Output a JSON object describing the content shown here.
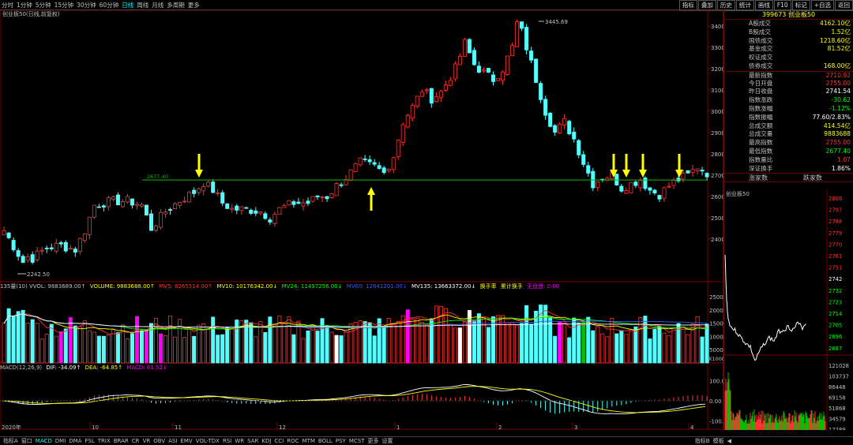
{
  "topbar": {
    "periods": [
      "分时",
      "1分钟",
      "5分钟",
      "15分钟",
      "30分钟",
      "60分钟",
      "日线",
      "周线",
      "月线",
      "多周期",
      "更多"
    ],
    "selected": "日线",
    "tools": [
      "指标",
      "叠加",
      "历史",
      "统计",
      "画线",
      "F10",
      "标记",
      "+自选",
      "返回"
    ]
  },
  "chart": {
    "title": "创业板50(日线,前复权)",
    "support_label": "2677.40",
    "high_label": "3445.69",
    "low_label": "2242.50",
    "price_axis": [
      "3400",
      "3300",
      "3200",
      "3100",
      "3000",
      "2900",
      "2800",
      "2700",
      "2600",
      "2500",
      "2400"
    ],
    "vol_axis": [
      "25000",
      "20000",
      "15000",
      "10000",
      "5000",
      "X1000"
    ],
    "macd_axis": [
      "100.00",
      "0.00",
      "-100.00"
    ],
    "x_axis": [
      "2020年",
      "10",
      "11",
      "12",
      "1",
      "2",
      "3",
      "4"
    ],
    "colors": {
      "up": "#ff3232",
      "down": "#54ffff",
      "support": "#00c000",
      "arrow": "#ffff00"
    }
  },
  "vol_title": {
    "p1": "135量(10) VVOL: 9883689.00↑",
    "volume": "VOLUME: 9883688.00↑",
    "mv5": "MV5: 8265514.00↑",
    "mv10": "MV10: 10176342.00↓",
    "mv24": "MV24: 11497256.00↓",
    "mv60": "MV60: 12641201.00↓",
    "mv135": "MV135: 13663372.00↓",
    "hs": "换手率",
    "lj": "累计换手",
    "cx": "无盘盘: 0.00"
  },
  "macd_title": {
    "p1": "MACD(12,26,9)",
    "dif": "DIF: -34.09↑",
    "dea": "DEA: -64.85↑",
    "macd": "MACD: 61.52↓"
  },
  "panel": {
    "title": "399673 创业板50",
    "rows": [
      {
        "label": "A股成交",
        "value": "4162.10亿",
        "color": "#ffff00"
      },
      {
        "label": "B股成交",
        "value": "1.52亿",
        "color": "#ffff00"
      },
      {
        "label": "国债成交",
        "value": "1218.60亿",
        "color": "#ffff00"
      },
      {
        "label": "基金成交",
        "value": "81.52亿",
        "color": "#ffff00"
      },
      {
        "label": "权证成交",
        "value": "",
        "color": "#ffff00"
      },
      {
        "label": "债券成交",
        "value": "168.00亿",
        "color": "#ffff00"
      },
      {
        "label": "最新指数",
        "value": "2710.92",
        "color": "#ff3232",
        "sep": true
      },
      {
        "label": "今日开盘",
        "value": "2755.00",
        "color": "#ff3232"
      },
      {
        "label": "昨日收盘",
        "value": "2741.54",
        "color": "#ffffff"
      },
      {
        "label": "指数涨跌",
        "value": "-30.62",
        "color": "#00ff00"
      },
      {
        "label": "指数涨幅",
        "value": "-1.12%",
        "color": "#00ff00"
      },
      {
        "label": "指数振幅",
        "value": "77.60/2.83%",
        "color": "#ffffff"
      },
      {
        "label": "总成交额",
        "value": "414.54亿",
        "color": "#ffff00"
      },
      {
        "label": "总成交量",
        "value": "9883688",
        "color": "#ffff00"
      },
      {
        "label": "最高指数",
        "value": "2755.00",
        "color": "#ff3232"
      },
      {
        "label": "最低指数",
        "value": "2677.40",
        "color": "#00ff00"
      },
      {
        "label": "指数量比",
        "value": "1.07",
        "color": "#ff3232"
      },
      {
        "label": "深证换手",
        "value": "1.86%",
        "color": "#ffffff"
      }
    ],
    "updown_left": "涨家数",
    "updown_right": "跌家数",
    "mini_title": "创业板50",
    "mini_price_axis": [
      "2806",
      "2797",
      "2788",
      "2779",
      "2770",
      "2761",
      "2751",
      "2742",
      "2732",
      "2723",
      "2714",
      "2705",
      "2696",
      "2687"
    ],
    "mini_vol_axis": [
      "121028",
      "103737",
      "86448",
      "69158",
      "51868",
      "34579",
      "17289"
    ]
  },
  "bottombar": {
    "items": [
      "指标A",
      "窗口",
      "MACD",
      "DMI",
      "DMA",
      "FSL",
      "TRIX",
      "BRAR",
      "CR",
      "VR",
      "OBV",
      "ASI",
      "EMV",
      "VOL-TDX",
      "RSI",
      "WR",
      "SAR",
      "KDJ",
      "CCI",
      "ROC",
      "MTM",
      "BOLL",
      "PSY",
      "MCST",
      "更多",
      "设置"
    ],
    "selected": "MACD",
    "right": [
      "指标B",
      "模板",
      "◀"
    ]
  }
}
